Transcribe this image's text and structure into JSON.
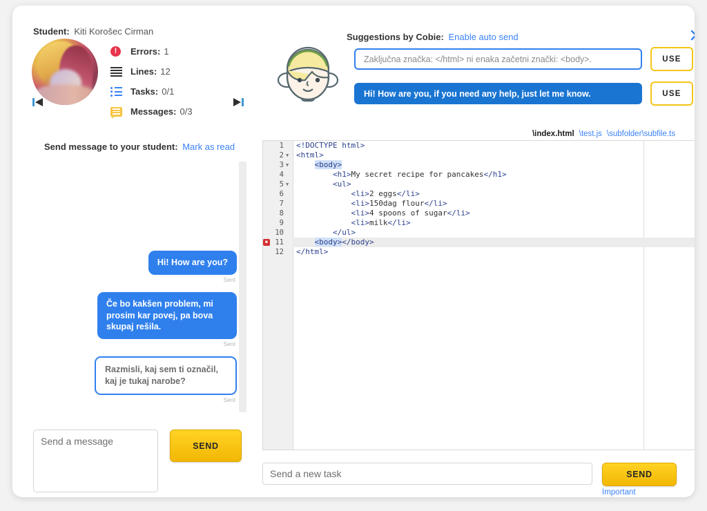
{
  "student_panel": {
    "student_label": "Student:",
    "student_name": "Kiti Korošec Cirman",
    "prev_icon": "previous-student-icon",
    "next_icon": "next-student-icon",
    "stats": [
      {
        "icon": "error-icon",
        "label": "Errors:",
        "value": "1"
      },
      {
        "icon": "lines-icon",
        "label": "Lines:",
        "value": "12"
      },
      {
        "icon": "tasks-icon",
        "label": "Tasks:",
        "value": "0/1"
      },
      {
        "icon": "messages-icon",
        "label": "Messages:",
        "value": "0/3"
      }
    ]
  },
  "chat": {
    "heading": "Send message to your student:",
    "mark_as_read": "Mark as read",
    "messages": [
      {
        "text": "Hi! How are you?",
        "status": "Sent",
        "kind": "sent"
      },
      {
        "text": "Če bo kakšen problem, mi prosim kar povej, pa bova skupaj rešila.",
        "status": "Sent",
        "kind": "sent"
      },
      {
        "text": "Razmisli, kaj sem ti označil, kaj je tukaj narobe?",
        "status": "Sent",
        "kind": "draft"
      }
    ],
    "composer_placeholder": "Send a message",
    "send_label": "SEND"
  },
  "suggestions": {
    "title": "Suggestions by Cobie:",
    "auto_send_link": "Enable auto send",
    "close_icon": "close-icon",
    "avatar_icon": "cobie-avatar-icon",
    "items": [
      {
        "text": "Zaključna značka: </html> ni enaka začetni znački: <body>.",
        "filled": false,
        "use_label": "USE"
      },
      {
        "text": "Hi! How are you, if you need any help, just let me know.",
        "filled": true,
        "use_label": "USE"
      }
    ]
  },
  "editor": {
    "file_tabs": [
      {
        "name": "\\index.html",
        "active": true
      },
      {
        "name": "\\test.js",
        "active": false
      },
      {
        "name": "\\subfolder\\subfile.ts",
        "active": false
      }
    ],
    "lines": [
      {
        "n": "1",
        "fold": false,
        "error": false,
        "indent": 0,
        "html": "<span class=\"tg\">&lt;!DOCTYPE html&gt;</span>"
      },
      {
        "n": "2",
        "fold": true,
        "error": false,
        "indent": 0,
        "html": "<span class=\"tg\">&lt;html&gt;</span>"
      },
      {
        "n": "3",
        "fold": true,
        "error": false,
        "indent": 1,
        "html": "    <span class=\"hl\">&lt;body&gt;</span>"
      },
      {
        "n": "4",
        "fold": false,
        "error": false,
        "indent": 2,
        "html": "        <span class=\"tg\">&lt;h1&gt;</span>My secret recipe for pancakes<span class=\"tg\">&lt;/h1&gt;</span>"
      },
      {
        "n": "5",
        "fold": true,
        "error": false,
        "indent": 2,
        "html": "        <span class=\"tg\">&lt;ul&gt;</span>"
      },
      {
        "n": "6",
        "fold": false,
        "error": false,
        "indent": 3,
        "html": "            <span class=\"tg\">&lt;li&gt;</span>2 eggs<span class=\"tg\">&lt;/li&gt;</span>"
      },
      {
        "n": "7",
        "fold": false,
        "error": false,
        "indent": 3,
        "html": "            <span class=\"tg\">&lt;li&gt;</span>150dag flour<span class=\"tg\">&lt;/li&gt;</span>"
      },
      {
        "n": "8",
        "fold": false,
        "error": false,
        "indent": 3,
        "html": "            <span class=\"tg\">&lt;li&gt;</span>4 spoons of sugar<span class=\"tg\">&lt;/li&gt;</span>"
      },
      {
        "n": "9",
        "fold": false,
        "error": false,
        "indent": 3,
        "html": "            <span class=\"tg\">&lt;li&gt;</span>milk<span class=\"tg\">&lt;/li&gt;</span>"
      },
      {
        "n": "10",
        "fold": false,
        "error": false,
        "indent": 2,
        "html": "        <span class=\"tg\">&lt;/ul&gt;</span>"
      },
      {
        "n": "11",
        "fold": false,
        "error": true,
        "indent": 1,
        "html": "    <span class=\"hl\">&lt;body&gt;</span><span class=\"tg\">&lt;/body&gt;</span>"
      },
      {
        "n": "12",
        "fold": false,
        "error": false,
        "indent": 0,
        "html": "<span class=\"tg\">&lt;/html&gt;</span>"
      }
    ],
    "error_marker_glyph": "✖"
  },
  "task_bar": {
    "placeholder": "Send a new task",
    "send_label": "SEND",
    "important_link": "Important"
  },
  "colors": {
    "accent_blue": "#2f80ed",
    "link_blue": "#3b82f6",
    "button_yellow": "#f2b705",
    "error_red": "#e8344a",
    "code_tag": "#2b3f8c",
    "highlight": "#cfe0f7"
  }
}
